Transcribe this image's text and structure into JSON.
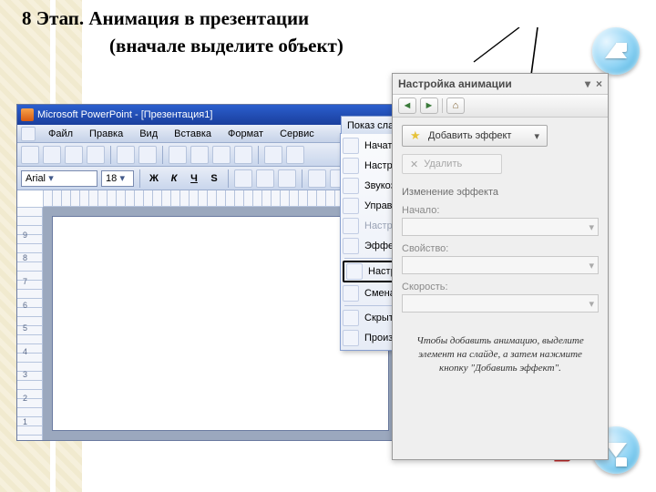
{
  "heading": {
    "title": "8 Этап. Анимация в презентации",
    "subtitle": "(вначале выделите объект)"
  },
  "pp": {
    "title": "Microsoft PowerPoint - [Презентация1]",
    "menu": {
      "file": "Файл",
      "edit": "Правка",
      "view": "Вид",
      "insert": "Вставка",
      "format": "Формат",
      "service": "Сервис"
    },
    "font": "Arial",
    "size": "18",
    "fmt": {
      "b": "Ж",
      "i": "К",
      "u": "Ч",
      "s": "S"
    },
    "ruler_nums": [
      "9",
      "8",
      "7",
      "6",
      "5",
      "4",
      "3",
      "2",
      "1"
    ]
  },
  "dropdown": {
    "header": "Показ слайдо",
    "items": [
      {
        "label": "Начать п",
        "disabled": false
      },
      {
        "label": "Настрой",
        "disabled": false
      },
      {
        "label": "Звукоза",
        "disabled": false
      },
      {
        "label": "Управля",
        "disabled": false
      },
      {
        "label": "Настрой",
        "disabled": true
      },
      {
        "label": "Эффекть",
        "disabled": false
      },
      {
        "label": "Настрой",
        "disabled": false,
        "boxed": true
      },
      {
        "label": "Смена сл",
        "disabled": false
      },
      {
        "label": "Скрыть с",
        "disabled": false
      },
      {
        "label": "Произво",
        "disabled": false
      }
    ]
  },
  "taskpane": {
    "title": "Настройка анимации",
    "add_effect": "Добавить эффект",
    "delete": "Удалить",
    "change_label": "Изменение эффекта",
    "start_label": "Начало:",
    "property_label": "Свойство:",
    "speed_label": "Скорость:",
    "hint": "Чтобы добавить анимацию, выделите элемент на слайде, а затем нажмите кнопку \"Добавить эффект\"."
  },
  "nav": {
    "up": "up",
    "down": "down"
  },
  "pointer": "☞"
}
